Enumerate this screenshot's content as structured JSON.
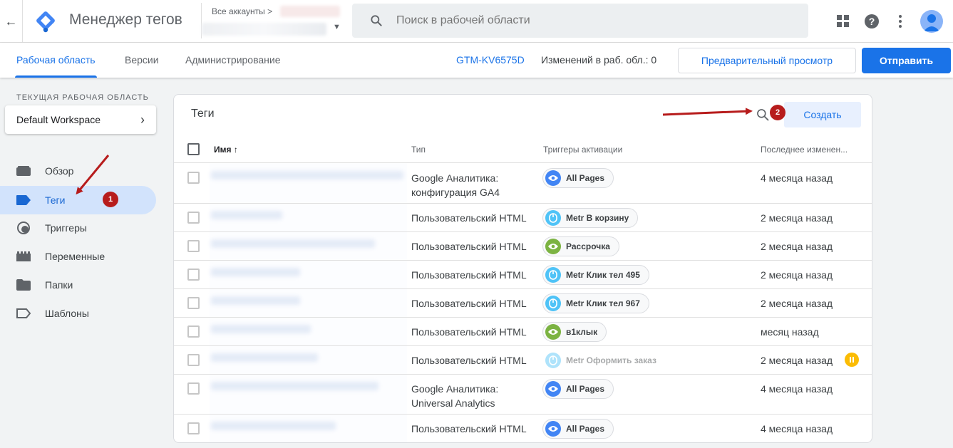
{
  "header": {
    "app_title": "Менеджер тегов",
    "accounts_label": "Все аккаунты",
    "search_placeholder": "Поиск в рабочей области"
  },
  "nav": {
    "tabs": [
      {
        "label": "Рабочая область",
        "active": true
      },
      {
        "label": "Версии",
        "active": false
      },
      {
        "label": "Администрирование",
        "active": false
      }
    ],
    "workspace_id": "GTM-KV6575D",
    "changes_label": "Изменений в раб. обл.: 0",
    "preview_label": "Предварительный просмотр",
    "submit_label": "Отправить"
  },
  "sidebar": {
    "current_ws_caption": "ТЕКУЩАЯ РАБОЧАЯ ОБЛАСТЬ",
    "workspace_name": "Default Workspace",
    "items": [
      {
        "label": "Обзор",
        "icon": "overview-icon"
      },
      {
        "label": "Теги",
        "icon": "tag-icon",
        "active": true
      },
      {
        "label": "Триггеры",
        "icon": "trigger-icon"
      },
      {
        "label": "Переменные",
        "icon": "variables-icon"
      },
      {
        "label": "Папки",
        "icon": "folder-icon"
      },
      {
        "label": "Шаблоны",
        "icon": "template-icon"
      }
    ]
  },
  "tags_panel": {
    "title": "Теги",
    "create_label": "Создать",
    "columns": {
      "name": "Имя",
      "type": "Тип",
      "triggers": "Триггеры активации",
      "last_changed": "Последнее изменен..."
    },
    "rows": [
      {
        "type": "Google Аналитика: конфигурация GA4",
        "trigger": "All Pages",
        "trigger_kind": "pageview",
        "time": "4 месяца назад"
      },
      {
        "type": "Пользовательский HTML",
        "trigger": "Metr В корзину",
        "trigger_kind": "click",
        "time": "2 месяца назад"
      },
      {
        "type": "Пользовательский HTML",
        "trigger": "Рассрочка",
        "trigger_kind": "pageview-green",
        "time": "2 месяца назад"
      },
      {
        "type": "Пользовательский HTML",
        "trigger": "Metr Клик тел 495",
        "trigger_kind": "click",
        "time": "2 месяца назад"
      },
      {
        "type": "Пользовательский HTML",
        "trigger": "Metr Клик тел 967",
        "trigger_kind": "click",
        "time": "2 месяца назад"
      },
      {
        "type": "Пользовательский HTML",
        "trigger": "в1клык",
        "trigger_kind": "pageview-green",
        "time": "месяц назад"
      },
      {
        "type": "Пользовательский HTML",
        "trigger": "Metr Оформить заказ",
        "trigger_kind": "click-disabled",
        "time": "2 месяца назад",
        "paused": true
      },
      {
        "type": "Google Аналитика: Universal Analytics",
        "trigger": "All Pages",
        "trigger_kind": "pageview",
        "time": "4 месяца назад"
      },
      {
        "type": "Пользовательский HTML",
        "trigger": "All Pages",
        "trigger_kind": "pageview",
        "time": "4 месяца назад"
      }
    ]
  },
  "annotations": {
    "badge1": "1",
    "badge2": "2"
  },
  "colors": {
    "accent": "#1a73e8",
    "active_bg": "#d2e3fc",
    "annotation_red": "#b71c1c",
    "paused_yellow": "#fbbc04"
  }
}
